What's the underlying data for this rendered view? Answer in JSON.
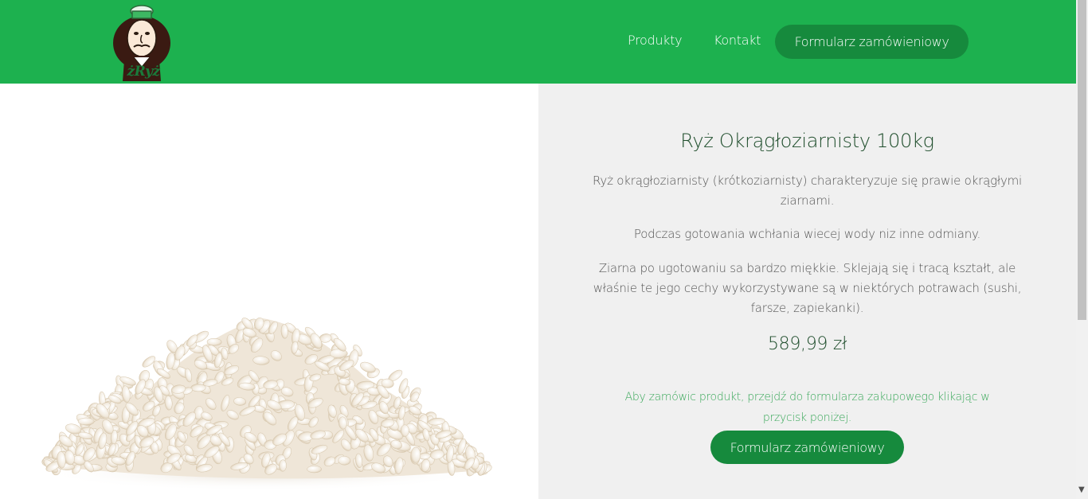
{
  "brand": {
    "logo_text": "żRyż"
  },
  "nav": {
    "produkty": "Produkty",
    "kontakt": "Kontakt",
    "cta": "Formularz zamówieniowy"
  },
  "product": {
    "title": "Ryż Okrągłoziarnisty 100kg",
    "description_1": "Ryż okrągłoziarnisty (krótkoziarnisty) charakteryzuje się prawie okrągłymi ziarnami.",
    "description_2": "Podczas gotowania wchłania wiecej wody niz inne odmiany.",
    "description_3": "Ziarna po ugotowaniu sa bardzo miękkie. Sklejają się i tracą kształt, ale właśnie te jego cechy wykorzystywane są w niektórych potrawach (sushi, farsze, zapiekanki).",
    "price": "589,99 zł",
    "order_note": "Aby zamówic produkt, przejdź do formularza zakupowego klikając w przycisk poniżej.",
    "order_button": "Formularz zamówieniowy"
  },
  "icons": {
    "logo": "chef-mascot-icon",
    "scroll_down": "chevron-down-icon"
  },
  "colors": {
    "header_green": "#1db14f",
    "button_green": "#168a3d",
    "title_green": "#1e4d2b",
    "note_green": "#3aa85a",
    "panel_bg": "#f0f0f0"
  }
}
